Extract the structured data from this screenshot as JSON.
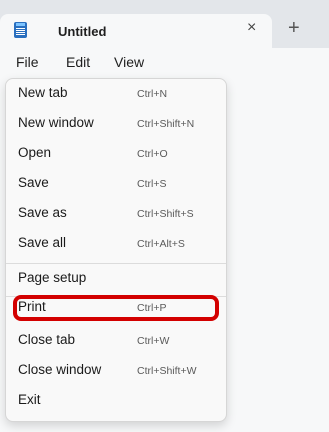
{
  "window": {
    "tab_title": "Untitled",
    "close_tab_glyph": "×",
    "new_tab_glyph": "+",
    "app_icon": "notepad-icon"
  },
  "menubar": {
    "file": "File",
    "edit": "Edit",
    "view": "View"
  },
  "file_menu": {
    "items": [
      {
        "label": "New tab",
        "shortcut": "Ctrl+N"
      },
      {
        "label": "New window",
        "shortcut": "Ctrl+Shift+N"
      },
      {
        "label": "Open",
        "shortcut": "Ctrl+O"
      },
      {
        "label": "Save",
        "shortcut": "Ctrl+S"
      },
      {
        "label": "Save as",
        "shortcut": "Ctrl+Shift+S"
      },
      {
        "label": "Save all",
        "shortcut": "Ctrl+Alt+S"
      },
      {
        "label": "Page setup",
        "shortcut": ""
      },
      {
        "label": "Print",
        "shortcut": "Ctrl+P"
      },
      {
        "label": "Close tab",
        "shortcut": "Ctrl+W"
      },
      {
        "label": "Close window",
        "shortcut": "Ctrl+Shift+W"
      },
      {
        "label": "Exit",
        "shortcut": ""
      }
    ],
    "highlight_color": "#d30000"
  }
}
